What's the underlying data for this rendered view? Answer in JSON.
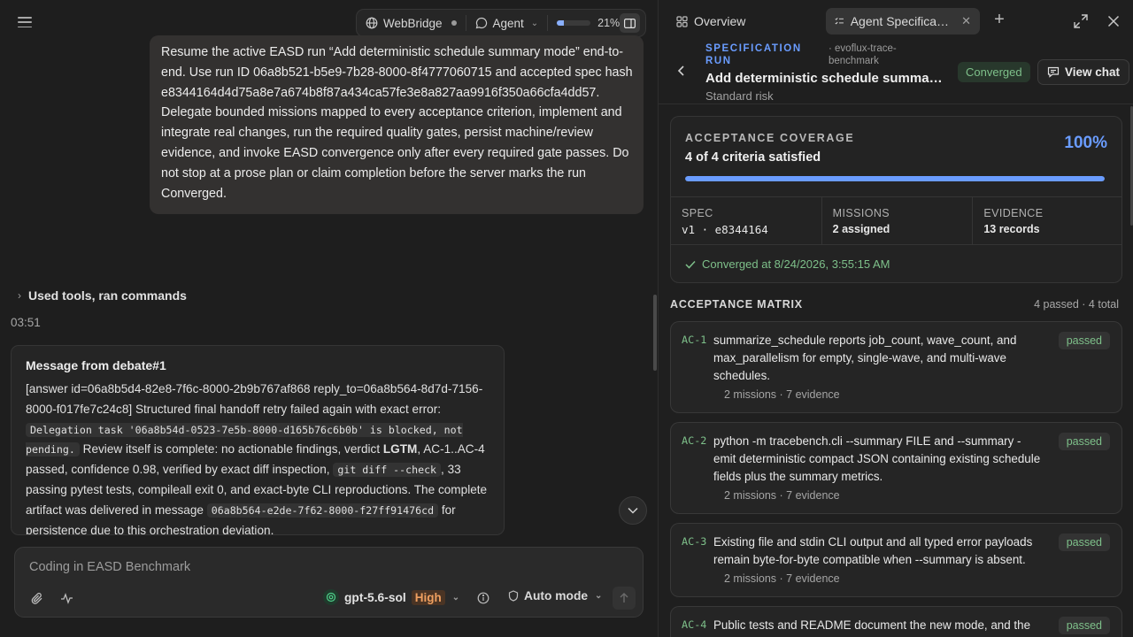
{
  "left": {
    "topbar": {
      "workspace": "WebBridge",
      "mode": "Agent",
      "progress_pct": 21,
      "progress_label": "21%"
    },
    "user_message": "Resume the active EASD run “Add deterministic schedule summary mode” end-to-end. Use run ID 06a8b521-b5e9-7b28-8000-8f4777060715 and accepted spec hash e8344164d4d75a8e7a674b8f87a434ca57fe3e8a827aa9916f350a66cfa4dd57. Delegate bounded missions mapped to every acceptance criterion, implement and integrate real changes, run the required quality gates, persist machine/review evidence, and invoke EASD convergence only after every required gate passes. Do not stop at a prose plan or claim completion before the server marks the run Converged.",
    "tools_summary": "Used tools, ran commands",
    "timestamp": "03:51",
    "debate": {
      "title": "Message from debate#1",
      "t1": "[answer id=06a8b5d4-82e8-7f6c-8000-2b9b767af868 reply_to=06a8b564-8d7d-7156-8000-f017fe7c24c8] Structured final handoff retry failed again with exact error: ",
      "code1": "Delegation task '06a8b54d-0523-7e5b-8000-d165b76c6b0b' is blocked, not pending.",
      "t2": " Review itself is complete: no actionable findings, verdict ",
      "verdict": "LGTM",
      "t3": ", AC-1..AC-4 passed, confidence 0.98, verified by exact diff inspection, ",
      "code2": "git diff --check",
      "t4": ", 33 passing pytest tests, compileall exit 0, and exact-byte CLI reproductions. The complete artifact was delivered in message ",
      "code3": "06a8b564-e2de-7f62-8000-f27ff91476cd",
      "t5": " for persistence due to this orchestration deviation."
    },
    "composer": {
      "placeholder": "Coding in EASD Benchmark",
      "model": "gpt-5.6-sol",
      "effort": "High",
      "permission_mode": "Auto mode"
    }
  },
  "right": {
    "tabs": {
      "overview": "Overview",
      "active": "Agent Specification Run"
    },
    "header": {
      "kicker": "SPECIFICATION RUN",
      "project": "· evoflux-trace-benchmark",
      "title": "Add deterministic schedule summary mode",
      "risk": "Standard risk",
      "status": "Converged",
      "view_chat": "View chat"
    },
    "coverage": {
      "label": "ACCEPTANCE COVERAGE",
      "summary": "4 of 4 criteria satisfied",
      "pct_label": "100%",
      "pct": 100,
      "spec_label": "SPEC",
      "spec_value": "v1 · e8344164",
      "missions_label": "MISSIONS",
      "missions_value": "2 assigned",
      "evidence_label": "EVIDENCE",
      "evidence_value": "13 records",
      "converged_at": "Converged at 8/24/2026, 3:55:15 AM"
    },
    "matrix": {
      "title": "ACCEPTANCE MATRIX",
      "count": "4 passed · 4 total",
      "items": [
        {
          "id": "AC-1",
          "text": "summarize_schedule reports job_count, wave_count, and max_parallelism for empty, single-wave, and multi-wave schedules.",
          "meta": "2 missions · 7 evidence",
          "status": "passed"
        },
        {
          "id": "AC-2",
          "text": "python -m tracebench.cli --summary FILE and --summary - emit deterministic compact JSON containing existing schedule fields plus the summary metrics.",
          "meta": "2 missions · 7 evidence",
          "status": "passed"
        },
        {
          "id": "AC-3",
          "text": "Existing file and stdin CLI output and all typed error payloads remain byte-for-byte compatible when --summary is absent.",
          "meta": "2 missions · 7 evidence",
          "status": "passed"
        },
        {
          "id": "AC-4",
          "text": "Public tests and README document the new mode, and the",
          "meta": "",
          "status": "passed"
        }
      ]
    }
  }
}
